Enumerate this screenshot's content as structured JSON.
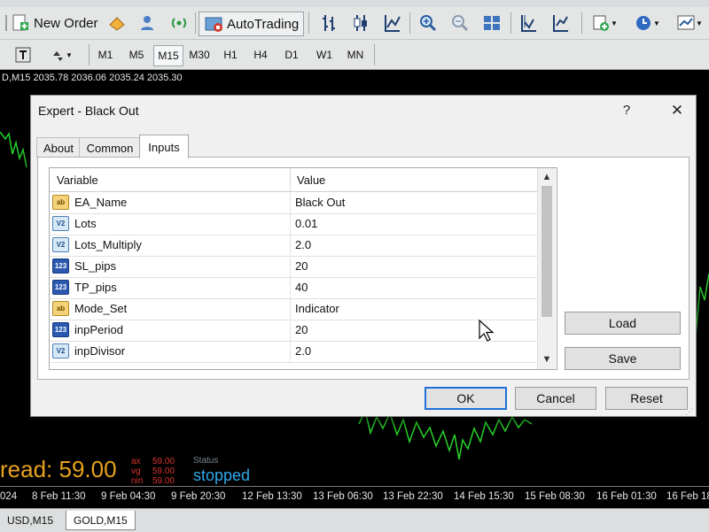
{
  "toolbar": {
    "new_order": "New Order",
    "autotrading": "AutoTrading",
    "timeframes": [
      "M1",
      "M5",
      "M15",
      "M30",
      "H1",
      "H4",
      "D1",
      "W1",
      "MN"
    ],
    "active_timeframe": "M15"
  },
  "chart": {
    "price_info": "D,M15 2035.78 2036.06 2035.24 2035.30",
    "spread_label": "read: 59.00",
    "mini": {
      "max": "ax",
      "max_val": "59.00",
      "avg": "vg",
      "avg_val": "59.00",
      "min": "nin",
      "min_val": "59.00"
    },
    "status_label": "Status",
    "status_value": "stopped",
    "time_labels": [
      "024",
      "8 Feb 11:30",
      "9 Feb 04:30",
      "9 Feb 20:30",
      "12 Feb 13:30",
      "13 Feb 06:30",
      "13 Feb 22:30",
      "14 Feb 15:30",
      "15 Feb 08:30",
      "16 Feb 01:30",
      "16 Feb 18"
    ],
    "line_color": "#27d22a"
  },
  "chart_tabs": [
    "USD,M15",
    "GOLD,M15"
  ],
  "dialog": {
    "title": "Expert - Black Out",
    "help": "?",
    "close": "✕",
    "tabs": [
      "About",
      "Common",
      "Inputs"
    ],
    "active_tab": "Inputs",
    "columns": {
      "variable": "Variable",
      "value": "Value"
    },
    "rows": [
      {
        "icon": "ab",
        "name": "EA_Name",
        "value": "Black Out"
      },
      {
        "icon": "V2",
        "name": "Lots",
        "value": "0.01"
      },
      {
        "icon": "V2",
        "name": "Lots_Multiply",
        "value": "2.0"
      },
      {
        "icon": "123",
        "name": "SL_pips",
        "value": "20"
      },
      {
        "icon": "123",
        "name": "TP_pips",
        "value": "40"
      },
      {
        "icon": "ab",
        "name": "Mode_Set",
        "value": "Indicator"
      },
      {
        "icon": "123",
        "name": "inpPeriod",
        "value": "20"
      },
      {
        "icon": "V2",
        "name": "inpDivisor",
        "value": "2.0"
      }
    ],
    "buttons": {
      "load": "Load",
      "save": "Save",
      "ok": "OK",
      "cancel": "Cancel",
      "reset": "Reset"
    }
  }
}
